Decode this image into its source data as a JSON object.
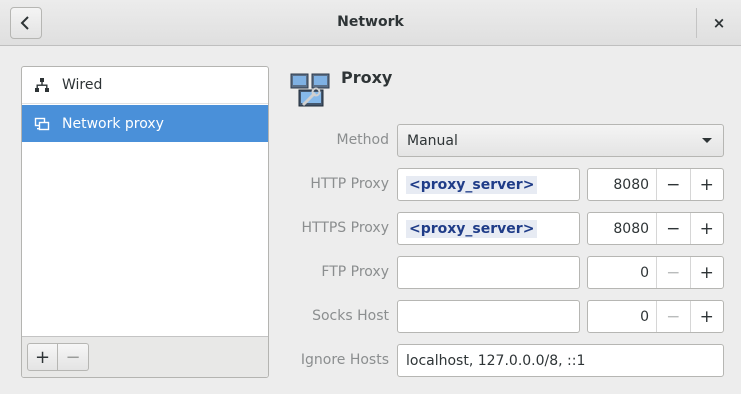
{
  "window": {
    "title": "Network"
  },
  "titlebar": {
    "back_icon": "chevron-left-icon",
    "close_label": "×"
  },
  "sidebar": {
    "items": [
      {
        "label": "Wired",
        "icon": "wired-network-icon",
        "selected": false
      },
      {
        "label": "Network proxy",
        "icon": "network-proxy-icon",
        "selected": true
      }
    ],
    "add_label": "+",
    "remove_label": "−"
  },
  "panel": {
    "title": "Proxy",
    "icon": "proxy-settings-icon",
    "method": {
      "label": "Method",
      "value": "Manual"
    },
    "rows": [
      {
        "label": "HTTP Proxy",
        "host": "<proxy_server>",
        "port": "8080",
        "minus_enabled": true
      },
      {
        "label": "HTTPS Proxy",
        "host": "<proxy_server>",
        "port": "8080",
        "minus_enabled": true
      },
      {
        "label": "FTP Proxy",
        "host": "",
        "port": "0",
        "minus_enabled": false
      },
      {
        "label": "Socks Host",
        "host": "",
        "port": "0",
        "minus_enabled": false
      }
    ],
    "ignore_hosts": {
      "label": "Ignore Hosts",
      "value": "localhost, 127.0.0.0/8, ::1"
    },
    "spin_minus": "−",
    "spin_plus": "+"
  },
  "colors": {
    "selection": "#4a90d9",
    "highlight_text": "#1f3c88"
  }
}
